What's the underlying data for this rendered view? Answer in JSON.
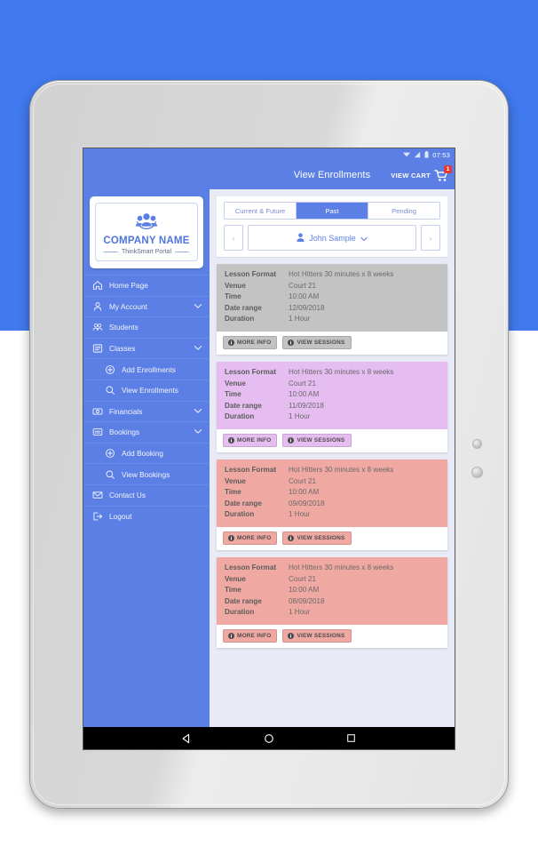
{
  "statusbar": {
    "time": "07:53",
    "icons": [
      "wifi-icon",
      "signal-icon",
      "battery-icon"
    ]
  },
  "appbar": {
    "title": "View Enrollments",
    "cart_label": "VIEW CART",
    "cart_badge": "1",
    "cart_icon": "shopping-cart-icon"
  },
  "logo": {
    "icon": "people-group-icon",
    "company_name": "COMPANY NAME",
    "subtitle": "ThinkSmart Portal"
  },
  "sidebar": {
    "items": [
      {
        "label": "Home Page",
        "icon": "home-icon",
        "sub": false,
        "chevron": false
      },
      {
        "label": "My Account",
        "icon": "person-icon",
        "sub": false,
        "chevron": true
      },
      {
        "label": "Students",
        "icon": "students-icon",
        "sub": false,
        "chevron": false
      },
      {
        "label": "Classes",
        "icon": "list-icon",
        "sub": false,
        "chevron": true
      },
      {
        "label": "Add Enrollments",
        "icon": "plus-circle-icon",
        "sub": true,
        "chevron": false
      },
      {
        "label": "View Enrollments",
        "icon": "search-icon",
        "sub": true,
        "chevron": false
      },
      {
        "label": "Financials",
        "icon": "money-icon",
        "sub": false,
        "chevron": true
      },
      {
        "label": "Bookings",
        "icon": "book-list-icon",
        "sub": false,
        "chevron": true
      },
      {
        "label": "Add Booking",
        "icon": "plus-circle-icon",
        "sub": true,
        "chevron": false
      },
      {
        "label": "View Bookings",
        "icon": "search-icon",
        "sub": true,
        "chevron": false
      },
      {
        "label": "Contact Us",
        "icon": "envelope-icon",
        "sub": false,
        "chevron": false
      },
      {
        "label": "Logout",
        "icon": "logout-icon",
        "sub": false,
        "chevron": false
      }
    ]
  },
  "filters": {
    "tabs": [
      {
        "label": "Current & Future",
        "active": false
      },
      {
        "label": "Past",
        "active": true
      },
      {
        "label": "Pending",
        "active": false
      }
    ],
    "prev_label": "‹",
    "next_label": "›",
    "student_name": "John Sample",
    "student_icon": "person-icon",
    "student_chevron": "chevron-down-icon"
  },
  "labels": {
    "lesson_format": "Lesson Format",
    "venue": "Venue",
    "time": "Time",
    "date_range": "Date range",
    "duration": "Duration",
    "more_info": "MORE INFO",
    "view_sessions": "VIEW SESSIONS"
  },
  "enrollments": [
    {
      "theme": "grey",
      "lesson_format": "Hot Hitters 30 minutes x 8 weeks",
      "venue": "Court 21",
      "time": "10:00 AM",
      "date_range": "12/09/2018",
      "duration": "1 Hour"
    },
    {
      "theme": "purple",
      "lesson_format": "Hot Hitters 30 minutes x 8 weeks",
      "venue": "Court 21",
      "time": "10:00 AM",
      "date_range": "11/09/2018",
      "duration": "1 Hour"
    },
    {
      "theme": "red",
      "lesson_format": "Hot Hitters 30 minutes x 8 weeks",
      "venue": "Court 21",
      "time": "10:00 AM",
      "date_range": "09/09/2018",
      "duration": "1 Hour"
    },
    {
      "theme": "red",
      "lesson_format": "Hot Hitters 30 minutes x 8 weeks",
      "venue": "Court 21",
      "time": "10:00 AM",
      "date_range": "08/09/2018",
      "duration": "1 Hour"
    }
  ],
  "navbar": {
    "back": "back-triangle-icon",
    "home": "home-circle-icon",
    "recents": "recents-square-icon"
  },
  "colors": {
    "backdrop_blue": "#4179ee",
    "brand_blue": "#5b7fe4",
    "content_bg": "#e8eaf6",
    "card_grey": "#c3c3c3",
    "card_purple": "#e5bdf0",
    "card_red": "#f0a8a2",
    "badge_red": "#e53935"
  }
}
